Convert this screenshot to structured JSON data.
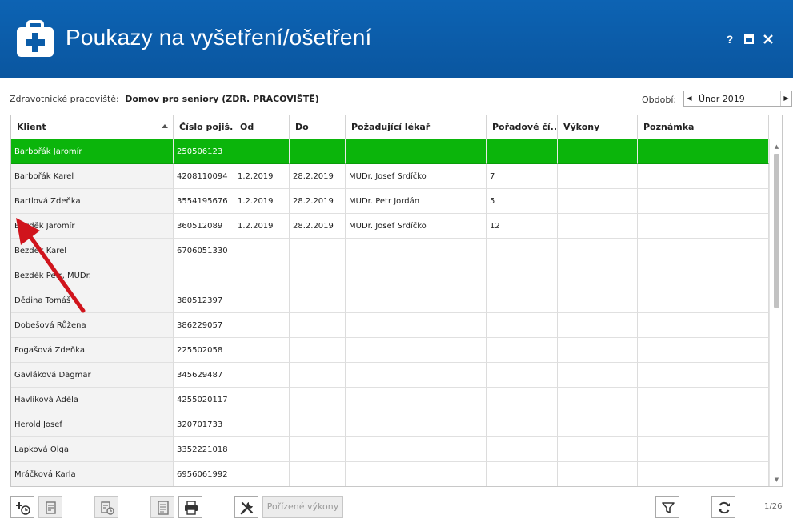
{
  "window": {
    "title": "Poukazy na vyšetření/ošetření",
    "icon": "first-aid-kit-icon",
    "buttons": {
      "help": "?",
      "maximize": "maximize-icon",
      "close": "close-icon"
    }
  },
  "info": {
    "workplace_label": "Zdravotnické pracoviště:",
    "workplace_value": "Domov pro seniory (ZDR. PRACOVIŠTĚ)",
    "period_label": "Období:",
    "period_value": "Únor 2019"
  },
  "grid": {
    "columns": [
      "Klient",
      "Číslo pojiš...",
      "Od",
      "Do",
      "Požadující lékař",
      "Pořadové čí...",
      "Výkony",
      "Poznámka"
    ],
    "sorted_column": "Klient",
    "rows": [
      [
        "Barbořák Jaromír",
        "250506123",
        "",
        "",
        "",
        "",
        "",
        ""
      ],
      [
        "Barbořák Karel",
        "4208110094",
        "1.2.2019",
        "28.2.2019",
        "MUDr. Josef Srdíčko",
        "7",
        "",
        ""
      ],
      [
        "Bartlová Zdeňka",
        "3554195676",
        "1.2.2019",
        "28.2.2019",
        "MUDr. Petr Jordán",
        "5",
        "",
        ""
      ],
      [
        "Bezděk Jaromír",
        "360512089",
        "1.2.2019",
        "28.2.2019",
        "MUDr. Josef Srdíčko",
        "12",
        "",
        ""
      ],
      [
        "Bezděk Karel",
        "6706051330",
        "",
        "",
        "",
        "",
        "",
        ""
      ],
      [
        "Bezděk Petr, MUDr.",
        "",
        "",
        "",
        "",
        "",
        "",
        ""
      ],
      [
        "Dědina Tomáš",
        "380512397",
        "",
        "",
        "",
        "",
        "",
        ""
      ],
      [
        "Dobešová Růžena",
        "386229057",
        "",
        "",
        "",
        "",
        "",
        ""
      ],
      [
        "Fogašová Zdeňka",
        "225502058",
        "",
        "",
        "",
        "",
        "",
        ""
      ],
      [
        "Gavláková Dagmar",
        "345629487",
        "",
        "",
        "",
        "",
        "",
        ""
      ],
      [
        "Havlíková Adéla",
        "4255020117",
        "",
        "",
        "",
        "",
        "",
        ""
      ],
      [
        "Herold Josef",
        "320701733",
        "",
        "",
        "",
        "",
        "",
        ""
      ],
      [
        "Lapková Olga",
        "3352221018",
        "",
        "",
        "",
        "",
        "",
        ""
      ],
      [
        "Mráčková Karla",
        "6956061992",
        "",
        "",
        "",
        "",
        "",
        ""
      ]
    ],
    "selected_row_color": "#0bb50b",
    "flag_color": "#f29a1c",
    "annotation_arrow_color": "#d0141c"
  },
  "toolbar": {
    "obtained_services_label": "Pořízené výkony",
    "pager": "1/26"
  }
}
